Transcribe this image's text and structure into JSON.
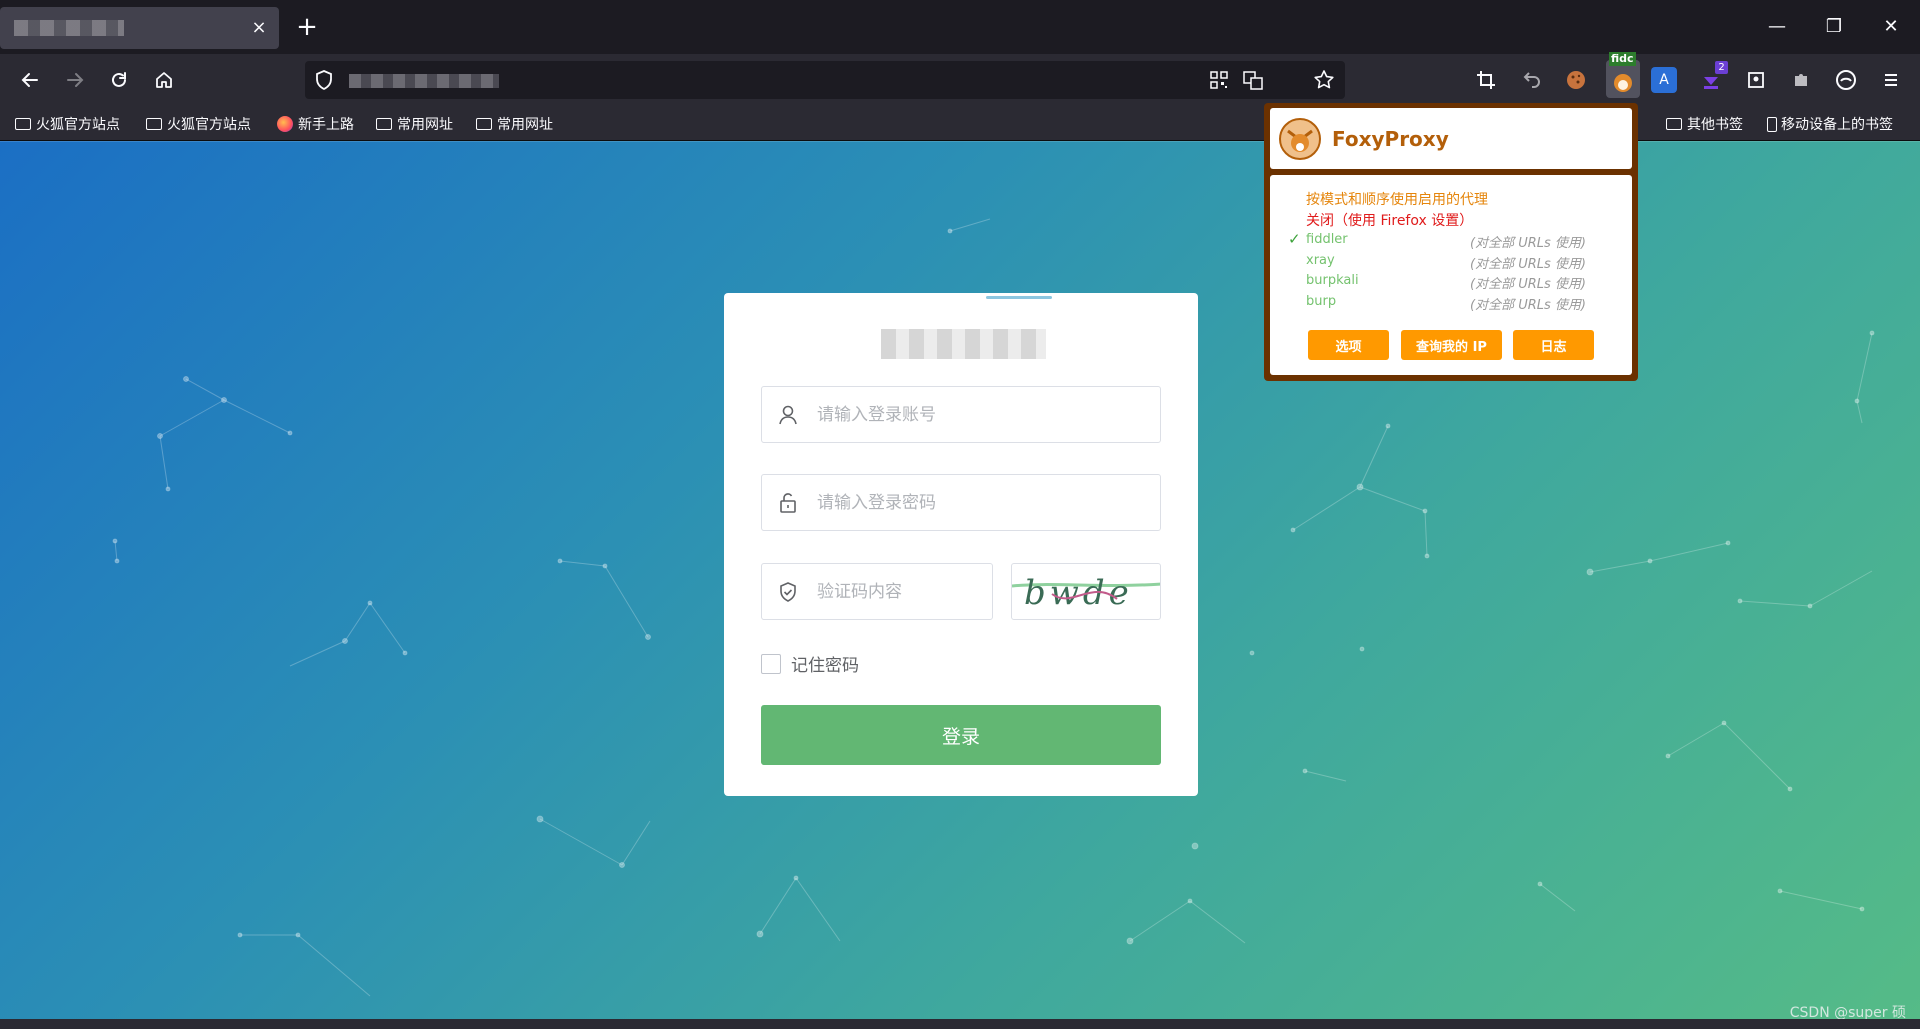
{
  "browser": {
    "tab_close": "×",
    "new_tab": "+",
    "win_min": "—",
    "win_restore": "❐",
    "win_close": "✕"
  },
  "bookmarks": {
    "left": [
      "火狐官方站点",
      "火狐官方站点",
      "新手上路",
      "常用网址",
      "常用网址"
    ],
    "other": "其他书签",
    "mobile": "移动设备上的书签"
  },
  "extensions": {
    "foxyproxy_badge": "fidc",
    "notification_count": "2",
    "translate_label": "A"
  },
  "login": {
    "username_placeholder": "请输入登录账号",
    "password_placeholder": "请输入登录密码",
    "captcha_placeholder": "验证码内容",
    "captcha_text": "bwde",
    "remember_label": "记住密码",
    "login_button": "登录"
  },
  "foxyproxy": {
    "title": "FoxyProxy",
    "mode_pattern": "按模式和顺序使用启用的代理",
    "mode_off": "关闭（使用 Firefox 设置）",
    "proxies": [
      {
        "name": "fiddler",
        "note": "(对全部 URLs 使用)",
        "selected": true
      },
      {
        "name": "xray",
        "note": "(对全部 URLs 使用)",
        "selected": false
      },
      {
        "name": "burpkali",
        "note": "(对全部 URLs 使用)",
        "selected": false
      },
      {
        "name": "burp",
        "note": "(对全部 URLs 使用)",
        "selected": false
      }
    ],
    "buttons": {
      "options": "选项",
      "myip": "查询我的 IP",
      "log": "日志"
    },
    "colors": {
      "frame": "#6b3100",
      "button": "#ff9900",
      "title": "#b35f0a",
      "proxy": "#74c26e"
    }
  },
  "watermark": "CSDN @super 硕"
}
